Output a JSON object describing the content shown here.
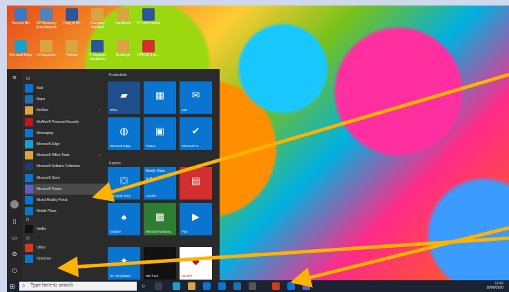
{
  "desktop_icons": [
    {
      "label": "Recycle Bin",
      "color": "#3a79c6"
    },
    {
      "label": "HP Recovery Scan/Restore",
      "color": "#4f83c0"
    },
    {
      "label": "Copy of HP",
      "color": "#2b579a"
    },
    {
      "label": "Company Handout",
      "color": "#d9a441"
    },
    {
      "label": "Handbook",
      "color": "#d9a441"
    },
    {
      "label": "PC Info Update",
      "color": "#2b579a"
    },
    {
      "label": "Microsoft Edge",
      "color": "#1aa0c9"
    },
    {
      "label": "Kit Inspector",
      "color": "#d9a441"
    },
    {
      "label": "Policies",
      "color": "#d9a441"
    },
    {
      "label": "IT Contacts Handbook",
      "color": "#2b579a"
    },
    {
      "label": "Bookings",
      "color": "#d9a441"
    },
    {
      "label": "PRESS 9 us...",
      "color": "#d32f2f"
    }
  ],
  "start_menu": {
    "rail_icons": [
      "hamburger-icon",
      "avatar-icon",
      "document-icon",
      "pictures-icon",
      "settings-icon",
      "power-icon"
    ],
    "apps": [
      {
        "type": "letter",
        "text": "M"
      },
      {
        "type": "app",
        "label": "Mail",
        "color": "#0a74d1"
      },
      {
        "type": "app",
        "label": "Maps",
        "color": "#1f6fb5"
      },
      {
        "type": "app",
        "label": "McAfee",
        "color": "#d9a441",
        "chev": "⌄"
      },
      {
        "type": "app",
        "label": "McAfee® Personal Security",
        "color": "#c0171c"
      },
      {
        "type": "app",
        "label": "Messaging",
        "color": "#0a74d1"
      },
      {
        "type": "app",
        "label": "Microsoft Edge",
        "color": "#1aa0c9"
      },
      {
        "type": "app",
        "label": "Microsoft Office Tools",
        "color": "#d9a441",
        "chev": "⌄"
      },
      {
        "type": "app",
        "label": "Microsoft Solitaire Collection",
        "color": "#1a3d6e"
      },
      {
        "type": "app",
        "label": "Microsoft Store",
        "color": "#0a74d1"
      },
      {
        "type": "app",
        "label": "Microsoft Teams",
        "color": "#5b5fc7",
        "highlight": true
      },
      {
        "type": "app",
        "label": "Mixed Reality Portal",
        "color": "#0a74d1"
      },
      {
        "type": "app",
        "label": "Mobile Plans",
        "color": "#0a74d1"
      },
      {
        "type": "letter",
        "text": "N"
      },
      {
        "type": "app",
        "label": "Netflix",
        "color": "#111111"
      },
      {
        "type": "letter",
        "text": "O"
      },
      {
        "type": "app",
        "label": "Office",
        "color": "#d13b1c"
      },
      {
        "type": "app",
        "label": "OneDrive",
        "color": "#0a74d1"
      }
    ],
    "groups": [
      "Productivity",
      "Explore"
    ],
    "tiles": [
      {
        "label": "Office",
        "glyph": "▰",
        "color": "#1f4f8a"
      },
      {
        "label": "",
        "glyph": "▦",
        "color": "#0a74d1"
      },
      {
        "label": "Mail",
        "glyph": "✉",
        "color": "#0a74d1"
      },
      {
        "label": "Microsoft Edge",
        "glyph": "◍",
        "color": "#0a74d1"
      },
      {
        "label": "Photos",
        "glyph": "▣",
        "color": "#0a74d1"
      },
      {
        "label": "Microsoft To...",
        "glyph": "✔",
        "color": "#0a74d1"
      },
      {
        "label": "Microsoft Store",
        "glyph": "⛋",
        "color": "#0a74d1"
      },
      {
        "label": "London",
        "glyph": "☁",
        "color": "#0a74d1"
      },
      {
        "label": "",
        "glyph": "▤",
        "color": "#d32f2f"
      },
      {
        "label": "Solitaire",
        "glyph": "♠",
        "color": "#0a74d1"
      },
      {
        "label": "Microsoft Mahjong",
        "glyph": "▩",
        "color": "#2e7d32"
      },
      {
        "label": "Play",
        "glyph": "▶",
        "color": "#0a74d1"
      },
      {
        "label": "HP JumpStarts",
        "glyph": "✦",
        "color": "#0a74d1"
      },
      {
        "label": "NETFLIX",
        "glyph": "",
        "color": "#111111"
      },
      {
        "label": "McAfee",
        "glyph": "◆",
        "color": "#ffffff"
      }
    ],
    "weather_text": "Mostly Clear",
    "weather_temp": "15°"
  },
  "taskbar": {
    "search_placeholder": "Type here to search",
    "time": "17:47",
    "date": "10/06/2020"
  }
}
